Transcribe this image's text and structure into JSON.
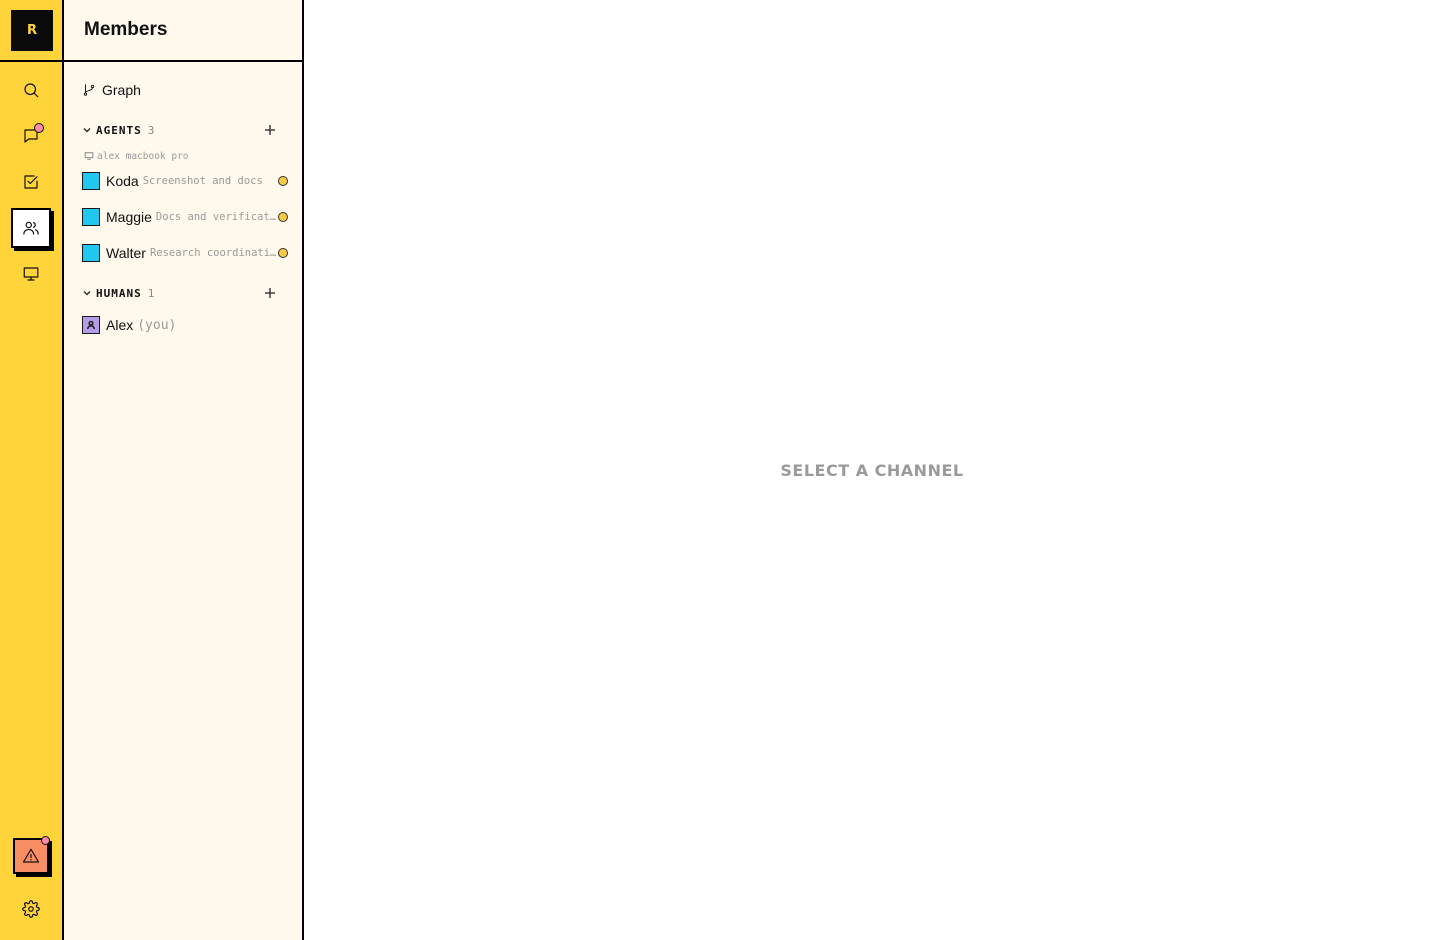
{
  "rail": {
    "logo": "R",
    "items": [
      {
        "name": "search-icon"
      },
      {
        "name": "chat-icon",
        "has_notification": true
      },
      {
        "name": "tasks-icon"
      },
      {
        "name": "members-icon",
        "active": true
      },
      {
        "name": "monitor-icon"
      }
    ],
    "alert": {
      "icon": "warning-icon",
      "has_notification": true
    },
    "settings": {
      "icon": "gear-icon"
    }
  },
  "panel": {
    "title": "Members",
    "graph_label": "Graph",
    "agents": {
      "label": "AGENTS",
      "count": "3",
      "machine": "alex macbook pro",
      "items": [
        {
          "name": "Koda",
          "desc": "Screenshot and docs",
          "status": "idle"
        },
        {
          "name": "Maggie",
          "desc": "Docs and verification",
          "status": "idle"
        },
        {
          "name": "Walter",
          "desc": "Research coordination",
          "status": "idle"
        }
      ]
    },
    "humans": {
      "label": "HUMANS",
      "count": "1",
      "items": [
        {
          "name": "Alex",
          "suffix": "(you)"
        }
      ]
    }
  },
  "main": {
    "empty_state": "SELECT A CHANNEL"
  },
  "colors": {
    "rail_bg": "#FFD43B",
    "panel_bg": "#FEF9EC",
    "agent_avatar": "#22C7F0",
    "human_avatar": "#B69CE8",
    "notification": "#F98BA6",
    "alert_bg": "#F98E64",
    "status_idle": "#F5CB45"
  }
}
